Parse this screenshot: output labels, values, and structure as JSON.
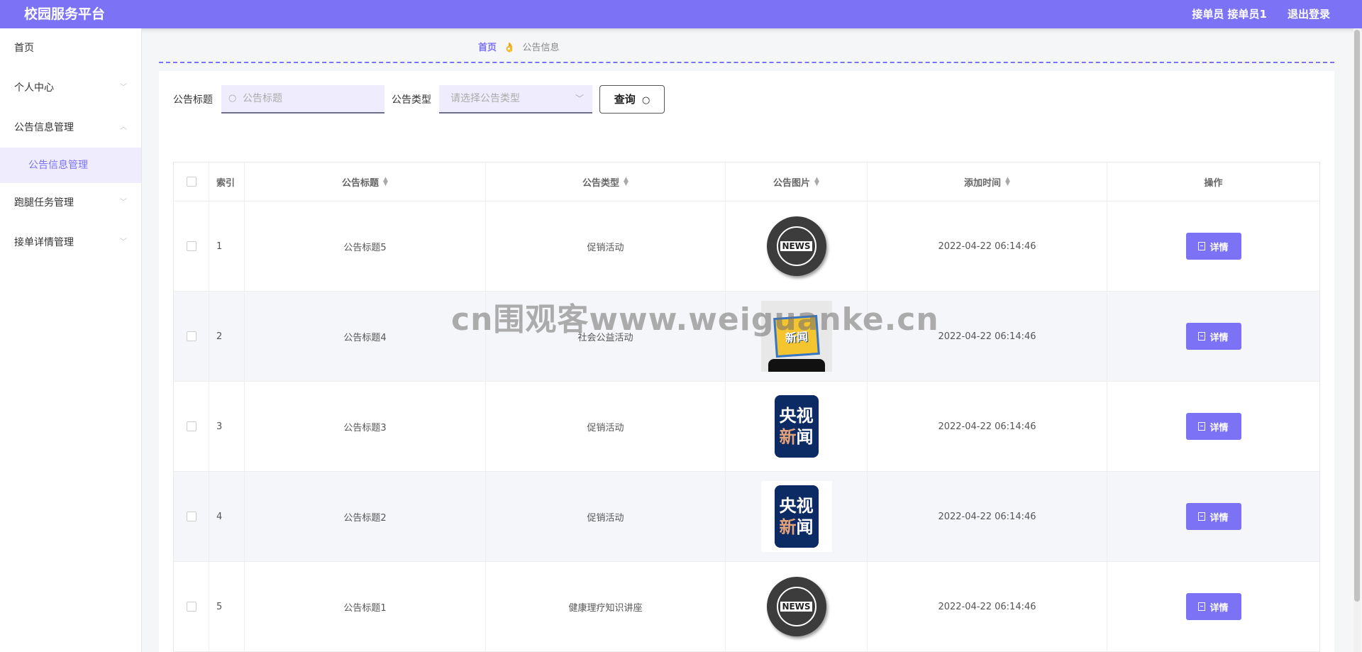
{
  "header": {
    "brand": "校园服务平台",
    "user_info": "接单员 接单员1",
    "logout": "退出登录"
  },
  "sidebar": {
    "items": [
      {
        "label": "首页"
      },
      {
        "label": "个人中心"
      },
      {
        "label": "公告信息管理"
      },
      {
        "label": "公告信息管理"
      },
      {
        "label": "跑腿任务管理"
      },
      {
        "label": "接单详情管理"
      }
    ]
  },
  "breadcrumb": {
    "home": "首页",
    "separator": "👌",
    "current": "公告信息"
  },
  "search": {
    "title_label": "公告标题",
    "title_placeholder": "公告标题",
    "type_label": "公告类型",
    "type_placeholder": "请选择公告类型",
    "query_button": "查询"
  },
  "table": {
    "headers": [
      "索引",
      "公告标题",
      "公告类型",
      "公告图片",
      "添加时间",
      "操作"
    ],
    "rows": [
      {
        "index": "1",
        "title": "公告标题5",
        "type": "促销活动",
        "image": "news-globe",
        "time": "2022-04-22 06:14:46",
        "action": "详情"
      },
      {
        "index": "2",
        "title": "公告标题4",
        "type": "社会公益活动",
        "image": "news-sticker",
        "time": "2022-04-22 06:14:46",
        "action": "详情"
      },
      {
        "index": "3",
        "title": "公告标题3",
        "type": "促销活动",
        "image": "cctv-news",
        "time": "2022-04-22 06:14:46",
        "action": "详情"
      },
      {
        "index": "4",
        "title": "公告标题2",
        "type": "促销活动",
        "image": "cctv-news",
        "time": "2022-04-22 06:14:46",
        "action": "详情"
      },
      {
        "index": "5",
        "title": "公告标题1",
        "type": "健康理疗知识讲座",
        "image": "news-globe",
        "time": "2022-04-22 06:14:46",
        "action": "详情"
      }
    ]
  },
  "images": {
    "news_globe_text": "NEWS",
    "sticker_text": "新闻",
    "cctv_line1": "央视",
    "cctv_line2_a": "新",
    "cctv_line2_b": "闻"
  },
  "watermark": "cn围观客www.weiguanke.cn",
  "colors": {
    "accent": "#7b72f6",
    "submenu_bg": "#efedfd"
  }
}
